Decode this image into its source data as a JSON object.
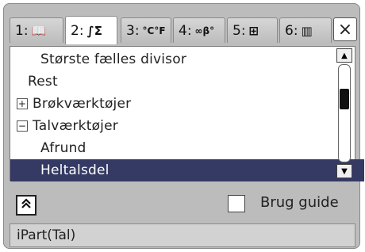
{
  "tabs": [
    {
      "num": "1:",
      "icon": "📖"
    },
    {
      "num": "2:",
      "icon": "∫Σ"
    },
    {
      "num": "3:",
      "icon": "°C°F"
    },
    {
      "num": "4:",
      "icon": "∞β°"
    },
    {
      "num": "5:",
      "icon": "⊞"
    },
    {
      "num": "6:",
      "icon": "▥"
    }
  ],
  "close_label": "×",
  "list": {
    "items": [
      {
        "label": "Største fælles divisor",
        "prefix": ""
      },
      {
        "label": "Rest",
        "prefix": ""
      },
      {
        "label": "Brøkværktøjer",
        "prefix": "+"
      },
      {
        "label": "Talværktøjer",
        "prefix": "−"
      },
      {
        "label": "Afrund",
        "prefix": ""
      },
      {
        "label": "Heltalsdel",
        "prefix": ""
      }
    ]
  },
  "bottom": {
    "collapse_symbol": "⌃",
    "guide_label": "Brug guide"
  },
  "syntax": "iPart(Tal)"
}
